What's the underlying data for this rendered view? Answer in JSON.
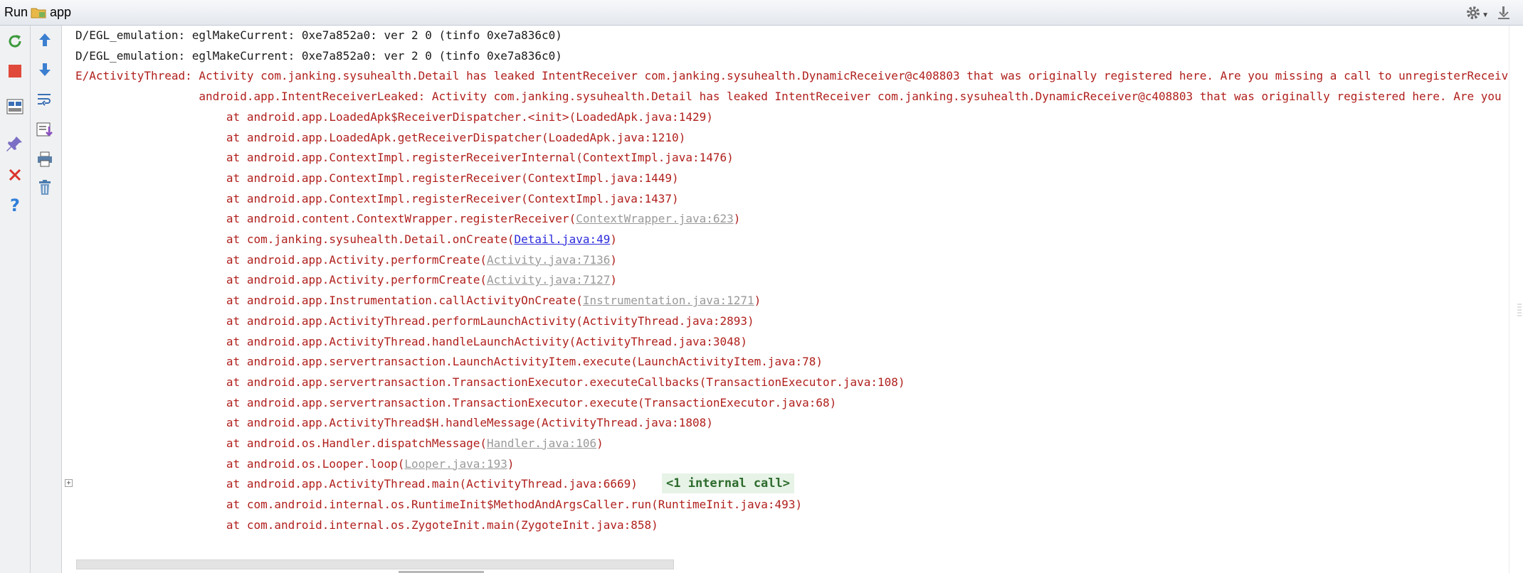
{
  "titlebar": {
    "run_label": "Run",
    "app_name": "app",
    "icons": [
      "app-folder-icon",
      "gear-icon",
      "chevron-down-icon",
      "pin-icon"
    ]
  },
  "toolbar_icons": [
    "rerun-icon",
    "stop-icon",
    "up-arrow-icon",
    "down-arrow-icon",
    "layout-icon",
    "soft-wrap-icon",
    "pin-tab-icon",
    "scroll-to-end-icon",
    "close-icon",
    "print-icon",
    "help-icon",
    "trash-icon"
  ],
  "colors": {
    "error_text": "#b0201d",
    "link_text": "#2a2adb",
    "greyed_link": "#9a9a9a",
    "internal_call_bg": "#e6f3e6"
  },
  "log": {
    "line0": "D/EGL_emulation: eglMakeCurrent: 0xe7a852a0: ver 2 0 (tinfo 0xe7a836c0)",
    "line1": "D/EGL_emulation: eglMakeCurrent: 0xe7a852a0: ver 2 0 (tinfo 0xe7a836c0)",
    "line2": "E/ActivityThread: Activity com.janking.sysuhealth.Detail has leaked IntentReceiver com.janking.sysuhealth.DynamicReceiver@c408803 that was originally registered here. Are you missing a call to unregisterReceiver()?",
    "line3": "                  android.app.IntentReceiverLeaked: Activity com.janking.sysuhealth.Detail has leaked IntentReceiver com.janking.sysuhealth.DynamicReceiver@c408803 that was originally registered here. Are you missing a call to unregisterReceiver()?",
    "f0": "                      at android.app.LoadedApk$ReceiverDispatcher.<init>(LoadedApk.java:1429)",
    "f1": "                      at android.app.LoadedApk.getReceiverDispatcher(LoadedApk.java:1210)",
    "f2": "                      at android.app.ContextImpl.registerReceiverInternal(ContextImpl.java:1476)",
    "f3": "                      at android.app.ContextImpl.registerReceiver(ContextImpl.java:1449)",
    "f4": "                      at android.app.ContextImpl.registerReceiver(ContextImpl.java:1437)",
    "f5_pre": "                      at android.content.ContextWrapper.registerReceiver(",
    "f5_link": "ContextWrapper.java:623",
    "f6_pre": "                      at com.janking.sysuhealth.Detail.onCreate(",
    "f6_link": "Detail.java:49",
    "f7_pre": "                      at android.app.Activity.performCreate(",
    "f7_link": "Activity.java:7136",
    "f8_pre": "                      at android.app.Activity.performCreate(",
    "f8_link": "Activity.java:7127",
    "f9_pre": "                      at android.app.Instrumentation.callActivityOnCreate(",
    "f9_link": "Instrumentation.java:1271",
    "f10": "                      at android.app.ActivityThread.performLaunchActivity(ActivityThread.java:2893)",
    "f11": "                      at android.app.ActivityThread.handleLaunchActivity(ActivityThread.java:3048)",
    "f12": "                      at android.app.servertransaction.LaunchActivityItem.execute(LaunchActivityItem.java:78)",
    "f13": "                      at android.app.servertransaction.TransactionExecutor.executeCallbacks(TransactionExecutor.java:108)",
    "f14": "                      at android.app.servertransaction.TransactionExecutor.execute(TransactionExecutor.java:68)",
    "f15": "                      at android.app.ActivityThread$H.handleMessage(ActivityThread.java:1808)",
    "f16_pre": "                      at android.os.Handler.dispatchMessage(",
    "f16_link": "Handler.java:106",
    "f17_pre": "                      at android.os.Looper.loop(",
    "f17_link": "Looper.java:193",
    "f18": "                      at android.app.ActivityThread.main(ActivityThread.java:6669)",
    "f18_internal": "<1 internal call>",
    "f19": "                      at com.android.internal.os.RuntimeInit$MethodAndArgsCaller.run(RuntimeInit.java:493)",
    "f20": "                      at com.android.internal.os.ZygoteInit.main(ZygoteInit.java:858)",
    "close_paren": ")",
    "expander_glyph": "+"
  }
}
